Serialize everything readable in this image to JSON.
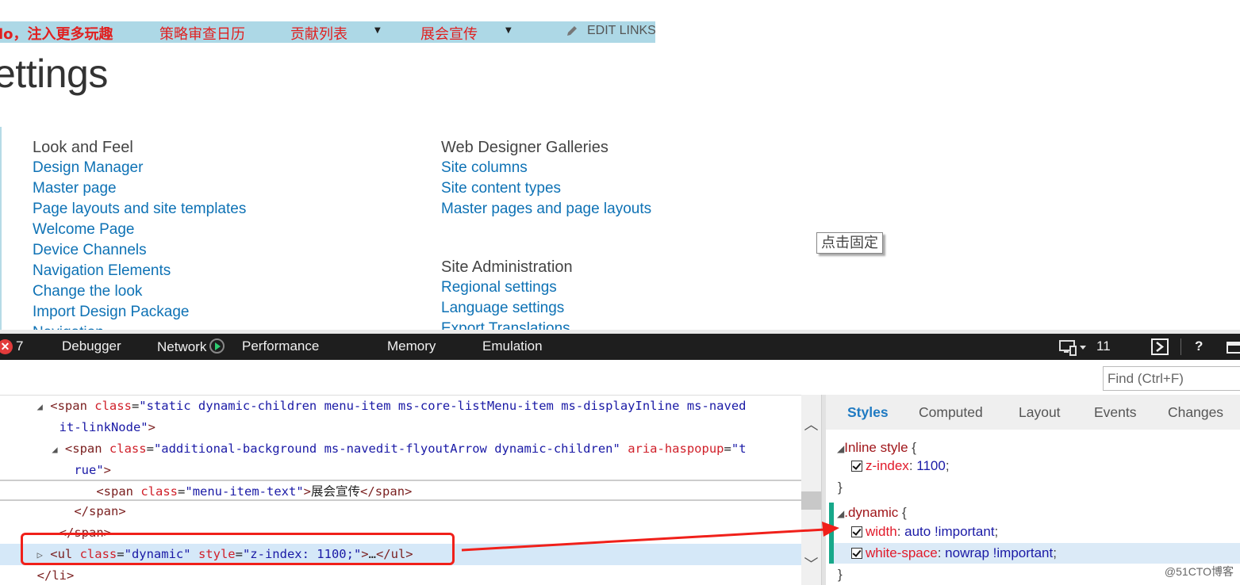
{
  "topnav": {
    "items": [
      {
        "label": "lo，注入更多玩趣",
        "bold": true
      },
      {
        "label": "策略审查日历"
      },
      {
        "label": "贡献列表",
        "has_dropdown": true
      },
      {
        "label": "展会宣传",
        "has_dropdown": true
      }
    ],
    "edit_links": "EDIT LINKS",
    "edit_icon": "pencil-icon"
  },
  "page_title": "ettings",
  "sections": {
    "look_and_feel": {
      "heading": "Look and Feel",
      "links": [
        "Design Manager",
        "Master page",
        "Page layouts and site templates",
        "Welcome Page",
        "Device Channels",
        "Navigation Elements",
        "Change the look",
        "Import Design Package",
        "Navigation"
      ]
    },
    "web_designer_galleries": {
      "heading": "Web Designer Galleries",
      "links": [
        "Site columns",
        "Site content types",
        "Master pages and page layouts"
      ]
    },
    "site_administration": {
      "heading": "Site Administration",
      "links": [
        "Regional settings",
        "Language settings",
        "Export Translations"
      ]
    }
  },
  "pin_tooltip": "点击固定",
  "devtools": {
    "error_count": "7",
    "tabs": [
      "Debugger",
      "Network",
      "Performance",
      "Memory",
      "Emulation"
    ],
    "emulation_count": "11",
    "icons": {
      "error": "error-icon",
      "network_record": "play-icon",
      "device": "device-emulation-icon",
      "console": "console-icon",
      "help": "help-icon",
      "undock": "undock-icon"
    },
    "find_placeholder": "Find (Ctrl+F)",
    "help_label": "?",
    "dom_lines": [
      {
        "tri": "◢",
        "tag_open": "<span",
        "attr": "class",
        "value": "\"static dynamic-children menu-item ms-core-listMenu-item ms-displayInline ms-naved"
      },
      {
        "value": "it-linkNode\"",
        "tag_close": ">"
      },
      {
        "tri": "◢",
        "tag_open": "<span",
        "attr": "class",
        "value": "\"additional-background ms-navedit-flyoutArrow dynamic-children\"",
        "attr2": "aria-haspopup",
        "value2": "\"t"
      },
      {
        "value": "rue\"",
        "tag_close": ">"
      },
      {
        "tag_open": "<span",
        "attr": "class",
        "value": "\"menu-item-text\"",
        "text": "展会宣传",
        "tag_end": "</span>"
      },
      {
        "tag_end": "</span>"
      },
      {
        "tag_end": "</span>"
      },
      {
        "tri": "▷",
        "tag_open": "<ul",
        "attr": "class",
        "value": "\"dynamic\"",
        "attr2": "style",
        "value2": "\"z-index: 1100;\"",
        "text": "…",
        "tag_end": "</ul>"
      },
      {
        "tag_end": "</li>"
      }
    ],
    "styles_tabs": [
      "Styles",
      "Computed",
      "Layout",
      "Events",
      "Changes"
    ],
    "active_styles_tab": "Styles",
    "rules": [
      {
        "selector": "Inline style",
        "props": [
          {
            "name": "z-index",
            "value": "1100",
            "checked": true
          }
        ]
      },
      {
        "selector": ".dynamic",
        "props": [
          {
            "name": "width",
            "value": "auto !important",
            "checked": true
          },
          {
            "name": "white-space",
            "value": "nowrap !important",
            "checked": true
          }
        ]
      }
    ]
  },
  "watermark": "@51CTO博客",
  "annotation_color": "#f0201a"
}
